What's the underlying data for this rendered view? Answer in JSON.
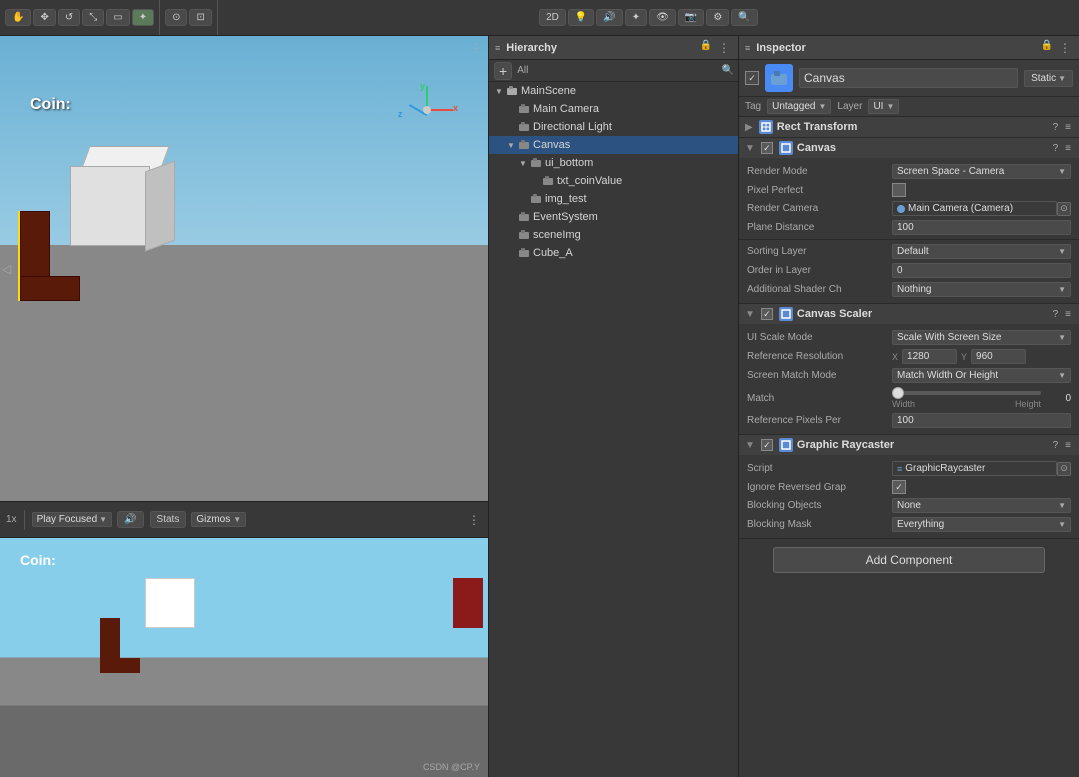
{
  "topToolbar": {
    "viewModeLabel": "2D",
    "moreLabel": "⋮"
  },
  "sceneView": {
    "coinLabel": "Coin:",
    "bottomStatusLeft": "1x",
    "playFocusedLabel": "Play Focused",
    "statsLabel": "Stats",
    "gizmosLabel": "Gizmos"
  },
  "hierarchy": {
    "title": "Hierarchy",
    "allLabel": "All",
    "items": [
      {
        "id": "mainscene",
        "label": "MainScene",
        "depth": 0,
        "expanded": true,
        "hasArrow": true
      },
      {
        "id": "maincamera",
        "label": "Main Camera",
        "depth": 1,
        "expanded": false,
        "hasArrow": false
      },
      {
        "id": "directionallight",
        "label": "Directional Light",
        "depth": 1,
        "expanded": false,
        "hasArrow": false
      },
      {
        "id": "canvas",
        "label": "Canvas",
        "depth": 1,
        "expanded": true,
        "hasArrow": true,
        "selected": true
      },
      {
        "id": "ui_bottom",
        "label": "ui_bottom",
        "depth": 2,
        "expanded": true,
        "hasArrow": true
      },
      {
        "id": "txt_coinvalue",
        "label": "txt_coinValue",
        "depth": 3,
        "expanded": false,
        "hasArrow": false
      },
      {
        "id": "img_test",
        "label": "img_test",
        "depth": 2,
        "expanded": false,
        "hasArrow": false
      },
      {
        "id": "eventsystem",
        "label": "EventSystem",
        "depth": 1,
        "expanded": false,
        "hasArrow": false
      },
      {
        "id": "sceneimg",
        "label": "sceneImg",
        "depth": 1,
        "expanded": false,
        "hasArrow": false
      },
      {
        "id": "cube_a",
        "label": "Cube_A",
        "depth": 1,
        "expanded": false,
        "hasArrow": false
      }
    ]
  },
  "inspector": {
    "title": "Inspector",
    "objectName": "Canvas",
    "staticLabel": "Static",
    "tagLabel": "Tag",
    "tagValue": "Untagged",
    "layerLabel": "Layer",
    "layerValue": "UI",
    "components": {
      "rectTransform": {
        "name": "Rect Transform",
        "helpIcon": "?",
        "settingsIcon": "≡"
      },
      "canvas": {
        "name": "Canvas",
        "enabled": true,
        "helpIcon": "?",
        "settingsIcon": "≡",
        "renderModeLabel": "Render Mode",
        "renderModeValue": "Screen Space - Camera",
        "pixelPerfectLabel": "Pixel Perfect",
        "renderCameraLabel": "Render Camera",
        "renderCameraValue": "Main Camera (Camera)",
        "planeDistanceLabel": "Plane Distance",
        "planeDistanceValue": "100",
        "sortingLayerLabel": "Sorting Layer",
        "sortingLayerValue": "Default",
        "orderInLayerLabel": "Order in Layer",
        "orderInLayerValue": "0",
        "additionalShaderLabel": "Additional Shader Ch",
        "additionalShaderValue": "Nothing"
      },
      "canvasScaler": {
        "name": "Canvas Scaler",
        "enabled": true,
        "helpIcon": "?",
        "settingsIcon": "≡",
        "uiScaleModeLabel": "UI Scale Mode",
        "uiScaleModeValue": "Scale With Screen Size",
        "referenceResolutionLabel": "Reference Resolution",
        "refResX": "1280",
        "refResXLabel": "X",
        "refResY": "960",
        "refResYLabel": "Y",
        "screenMatchModeLabel": "Screen Match Mode",
        "screenMatchModeValue": "Match Width Or Height",
        "matchLabel": "Match",
        "matchValue": "0",
        "widthLabel": "Width",
        "heightLabel": "Height",
        "referencePixelsLabel": "Reference Pixels Per",
        "referencePixelsValue": "100"
      },
      "graphicRaycaster": {
        "name": "Graphic Raycaster",
        "enabled": true,
        "helpIcon": "?",
        "settingsIcon": "≡",
        "scriptLabel": "Script",
        "scriptValue": "GraphicRaycaster",
        "ignoreReversedLabel": "Ignore Reversed Grap",
        "blockingObjectsLabel": "Blocking Objects",
        "blockingObjectsValue": "None",
        "blockingMaskLabel": "Blocking Mask",
        "blockingMaskValue": "Everything"
      }
    },
    "addComponentLabel": "Add Component"
  },
  "playView": {
    "coinLabel": "Coin:",
    "watermark": "CSDN @CP.Y"
  }
}
